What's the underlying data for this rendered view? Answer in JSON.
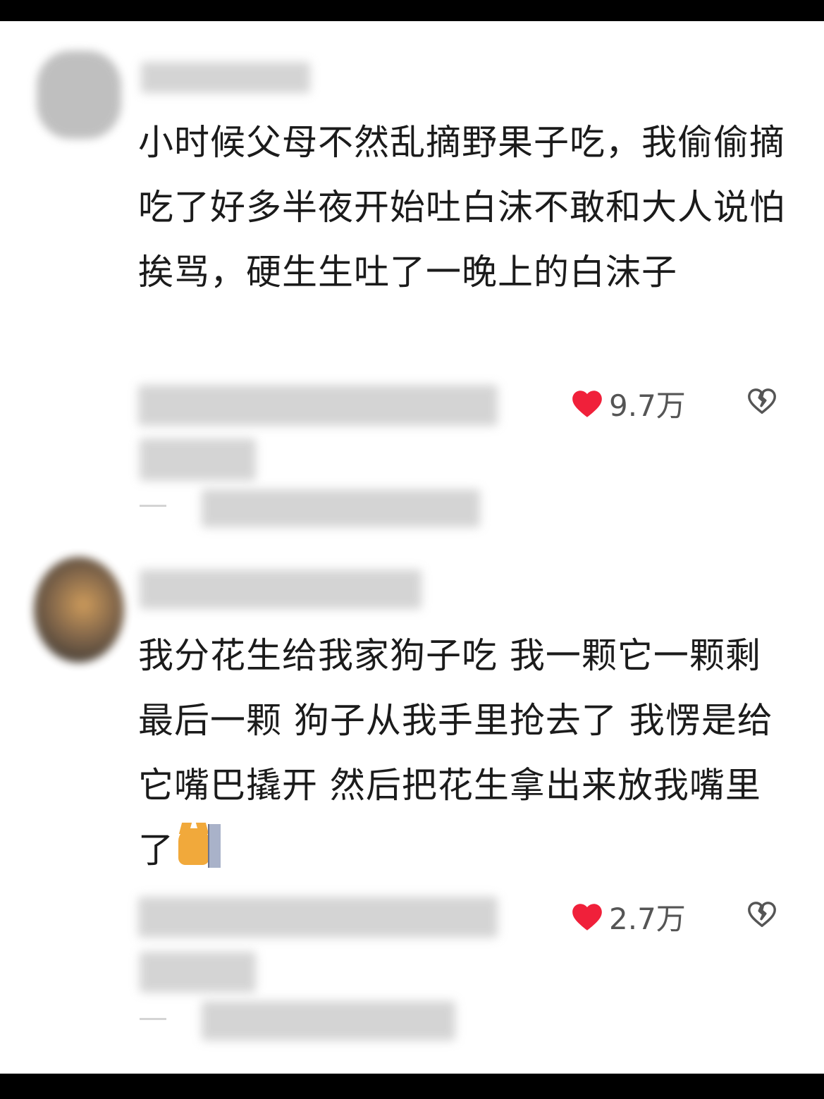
{
  "comments": [
    {
      "text": "小时候父母不然乱摘野果子吃，我偷偷摘吃了好多半夜开始吐白沫不敢和大人说怕挨骂，硬生生吐了一晚上的白沫子",
      "likes": "9.7万"
    },
    {
      "text": "我分花生给我家狗子吃 我一颗它一颗剩最后一颗 狗子从我手里抢去了 我愣是给它嘴巴撬开 然后把花生拿出来放我嘴里了",
      "emoji": "cat-peeking-icon",
      "likes": "2.7万"
    }
  ],
  "colors": {
    "heart": "#f0203a",
    "text": "#1b1b1b",
    "count": "#555555"
  }
}
